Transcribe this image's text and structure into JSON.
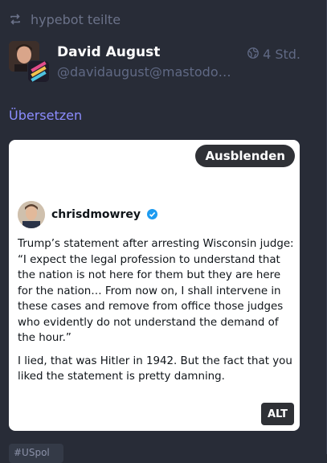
{
  "boost": {
    "icon": "boost-icon",
    "text": "hypebot teilte"
  },
  "account": {
    "display_name": "David August",
    "acct": "@davidaugust@mastodon....",
    "visibility_icon": "globe-icon",
    "time": "4 Std."
  },
  "translate_label": "Übersetzen",
  "media": {
    "hide_label": "Ausblenden",
    "alt_label": "ALT",
    "embedded_post": {
      "handle": "chrisdmowrey",
      "verified_icon": "verified-badge-icon",
      "paragraph_1": "Trump’s statement after arresting Wisconsin judge: “I expect the legal profession to understand that the nation is not here for them but they are here for the nation… From now on, I shall intervene in these cases and remove from office those judges who evidently do not understand the demand of the hour.”",
      "paragraph_2": "I lied, that was Hitler in 1942. But the fact that you liked the statement is pretty damning."
    }
  },
  "hashtag": "#USpol",
  "colors": {
    "background": "#282c37",
    "muted": "#606984",
    "link": "#8c8dff",
    "verified": "#1d9bf0",
    "dark_button": "#2f3136"
  }
}
